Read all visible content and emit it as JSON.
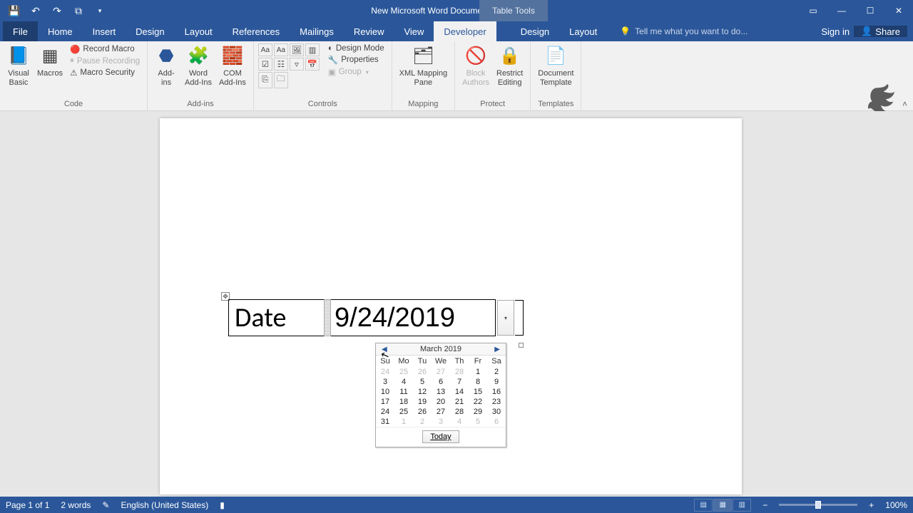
{
  "title": {
    "doc": "New Microsoft Word Document.docx - Word",
    "context": "Table Tools"
  },
  "tabs": {
    "file": "File",
    "home": "Home",
    "insert": "Insert",
    "design": "Design",
    "layout": "Layout",
    "references": "References",
    "mailings": "Mailings",
    "review": "Review",
    "view": "View",
    "developer": "Developer",
    "tt_design": "Design",
    "tt_layout": "Layout",
    "tellme": "Tell me what you want to do...",
    "signin": "Sign in",
    "share": "Share"
  },
  "ribbon": {
    "code": {
      "label": "Code",
      "visual_basic": "Visual\nBasic",
      "macros": "Macros",
      "record": "Record Macro",
      "pause": "Pause Recording",
      "security": "Macro Security"
    },
    "addins": {
      "label": "Add-ins",
      "addins": "Add-\nins",
      "word": "Word\nAdd-Ins",
      "com": "COM\nAdd-Ins"
    },
    "controls": {
      "label": "Controls",
      "design_mode": "Design Mode",
      "properties": "Properties",
      "group": "Group"
    },
    "mapping": {
      "label": "Mapping",
      "xml": "XML Mapping\nPane"
    },
    "protect": {
      "label": "Protect",
      "block": "Block\nAuthors",
      "restrict": "Restrict\nEditing"
    },
    "templates": {
      "label": "Templates",
      "template": "Document\nTemplate"
    }
  },
  "document": {
    "cell_label": "Date",
    "cell_value": "9/24/2019"
  },
  "calendar": {
    "month": "March 2019",
    "dow": [
      "Su",
      "Mo",
      "Tu",
      "We",
      "Th",
      "Fr",
      "Sa"
    ],
    "rows": [
      [
        {
          "d": "24",
          "off": true
        },
        {
          "d": "25",
          "off": true
        },
        {
          "d": "26",
          "off": true
        },
        {
          "d": "27",
          "off": true
        },
        {
          "d": "28",
          "off": true
        },
        {
          "d": "1"
        },
        {
          "d": "2"
        }
      ],
      [
        {
          "d": "3"
        },
        {
          "d": "4"
        },
        {
          "d": "5"
        },
        {
          "d": "6"
        },
        {
          "d": "7"
        },
        {
          "d": "8"
        },
        {
          "d": "9"
        }
      ],
      [
        {
          "d": "10"
        },
        {
          "d": "11"
        },
        {
          "d": "12"
        },
        {
          "d": "13"
        },
        {
          "d": "14"
        },
        {
          "d": "15"
        },
        {
          "d": "16"
        }
      ],
      [
        {
          "d": "17"
        },
        {
          "d": "18"
        },
        {
          "d": "19"
        },
        {
          "d": "20"
        },
        {
          "d": "21"
        },
        {
          "d": "22"
        },
        {
          "d": "23"
        }
      ],
      [
        {
          "d": "24"
        },
        {
          "d": "25"
        },
        {
          "d": "26"
        },
        {
          "d": "27"
        },
        {
          "d": "28"
        },
        {
          "d": "29"
        },
        {
          "d": "30"
        }
      ],
      [
        {
          "d": "31"
        },
        {
          "d": "1",
          "off": true
        },
        {
          "d": "2",
          "off": true
        },
        {
          "d": "3",
          "off": true
        },
        {
          "d": "4",
          "off": true
        },
        {
          "d": "5",
          "off": true
        },
        {
          "d": "6",
          "off": true
        }
      ]
    ],
    "today": "Today"
  },
  "status": {
    "page": "Page 1 of 1",
    "words": "2 words",
    "lang": "English (United States)",
    "zoom": "100%"
  }
}
